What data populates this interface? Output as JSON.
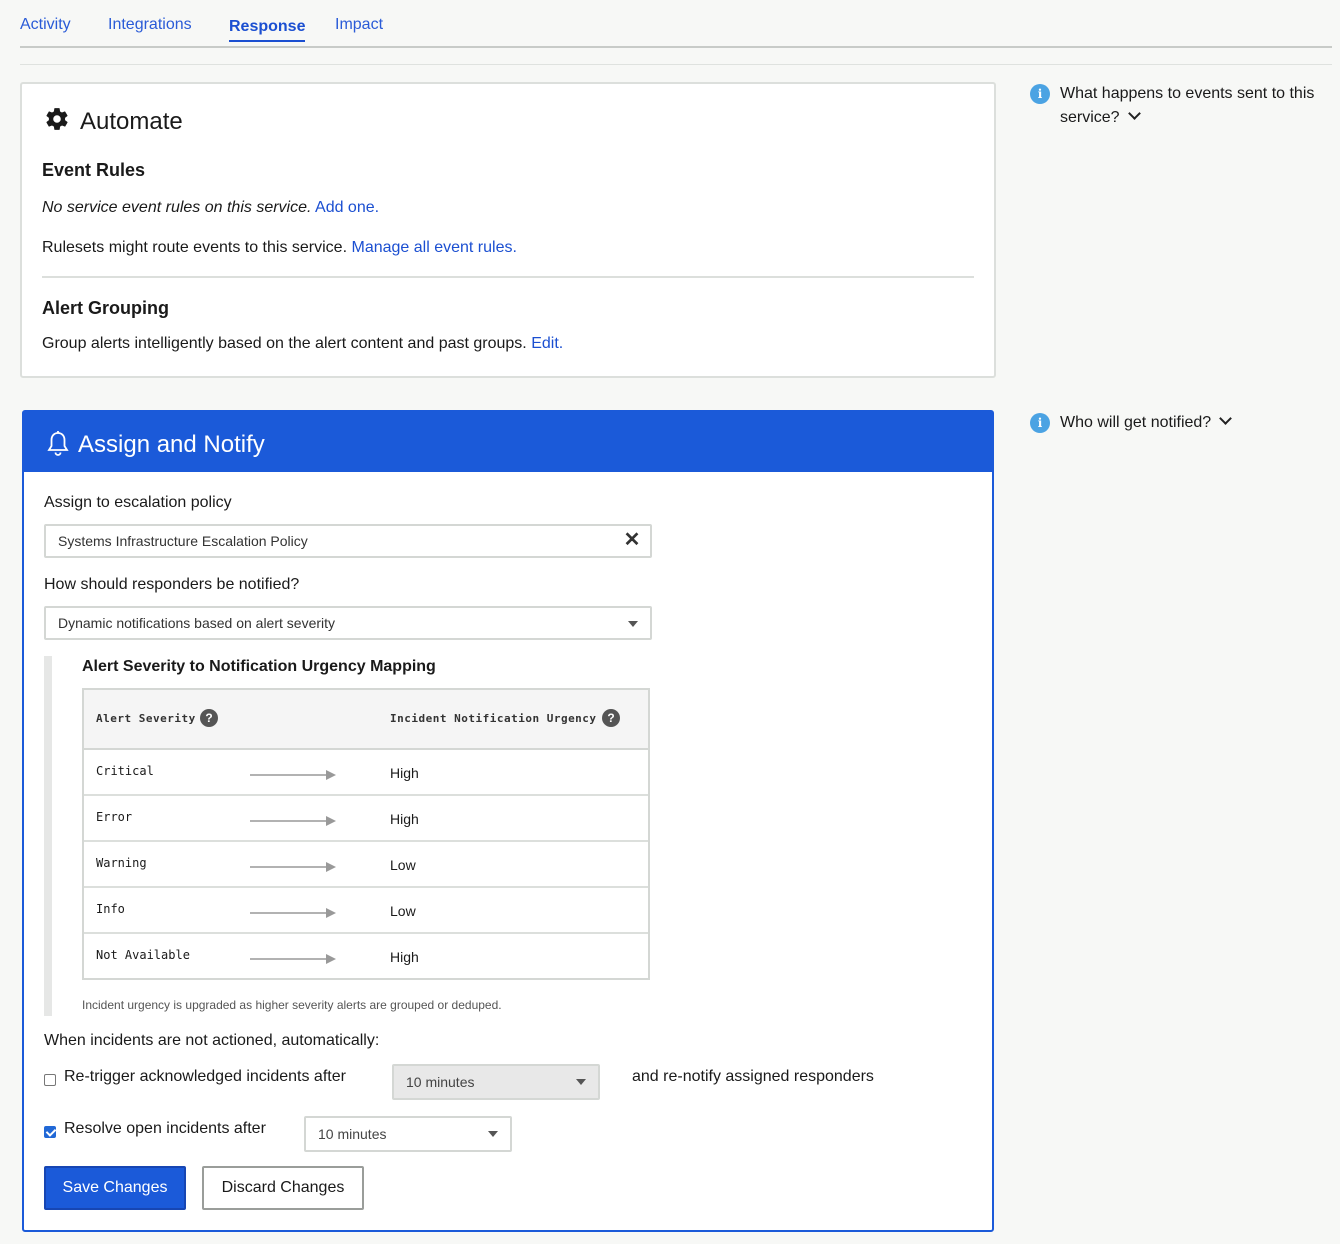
{
  "tabs": [
    {
      "label": "Activity"
    },
    {
      "label": "Integrations"
    },
    {
      "label": "Response",
      "active": true
    },
    {
      "label": "Impact"
    }
  ],
  "automate": {
    "title": "Automate",
    "icon": "gear-icon",
    "event_rules": {
      "heading": "Event Rules",
      "none_text": "No service event rules on this service.",
      "add_link": "Add one.",
      "rulesets_text": "Rulesets might route events to this service.",
      "manage_link": "Manage all event rules."
    },
    "alert_grouping": {
      "heading": "Alert Grouping",
      "text": "Group alerts intelligently based on the alert content and past groups.",
      "edit_link": "Edit."
    }
  },
  "assign": {
    "title": "Assign and Notify",
    "icon": "bell-icon",
    "escalation_label": "Assign to escalation policy",
    "escalation_value": "Systems Infrastructure Escalation Policy",
    "notify_label": "How should responders be notified?",
    "notify_value": "Dynamic notifications based on alert severity",
    "mapping": {
      "title": "Alert Severity to Notification Urgency Mapping",
      "col_severity": "Alert Severity",
      "col_urgency": "Incident Notification Urgency",
      "rows": [
        {
          "severity": "Critical",
          "urgency": "High"
        },
        {
          "severity": "Error",
          "urgency": "High"
        },
        {
          "severity": "Warning",
          "urgency": "Low"
        },
        {
          "severity": "Info",
          "urgency": "Low"
        },
        {
          "severity": "Not Available",
          "urgency": "High"
        }
      ],
      "note": "Incident urgency is upgraded as higher severity alerts are grouped or deduped."
    },
    "not_actioned_label": "When incidents are not actioned, automatically:",
    "retrigger": {
      "checked": false,
      "label": "Re-trigger acknowledged incidents after",
      "value": "10 minutes",
      "suffix": "and re-notify assigned responders"
    },
    "resolve": {
      "checked": true,
      "label": "Resolve open incidents after",
      "value": "10 minutes"
    },
    "save_label": "Save Changes",
    "discard_label": "Discard Changes"
  },
  "side": {
    "events_help": "What happens to events sent to this service?",
    "notified_help": "Who will get notified?"
  },
  "colors": {
    "brand_blue": "#1b5ad9",
    "link_blue": "#1b4fd1",
    "info_blue": "#4ba3e3"
  }
}
